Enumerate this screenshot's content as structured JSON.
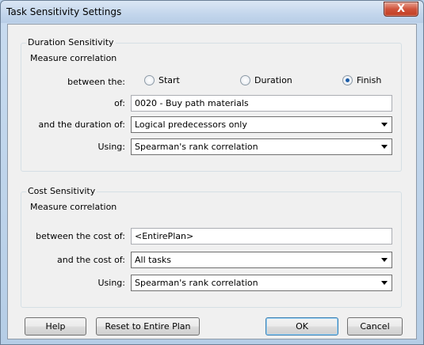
{
  "window": {
    "title": "Task Sensitivity Settings",
    "close_glyph": "X"
  },
  "duration": {
    "legend": "Duration Sensitivity",
    "measure": "Measure correlation",
    "between_label": "between the:",
    "radios": [
      {
        "label": "Start",
        "selected": false
      },
      {
        "label": "Duration",
        "selected": false
      },
      {
        "label": "Finish",
        "selected": true
      }
    ],
    "of_label": "of:",
    "of_value": "0020 - Buy path materials",
    "duration_of_label": "and the duration of:",
    "duration_of_value": "Logical predecessors only",
    "using_label": "Using:",
    "using_value": "Spearman's rank correlation"
  },
  "cost": {
    "legend": "Cost Sensitivity",
    "measure": "Measure correlation",
    "between_label": "between the cost of:",
    "between_value": "<EntirePlan>",
    "cost_of_label": "and the cost of:",
    "cost_of_value": "All tasks",
    "using_label": "Using:",
    "using_value": "Spearman's rank correlation"
  },
  "buttons": {
    "help": "Help",
    "reset": "Reset to Entire Plan",
    "ok": "OK",
    "cancel": "Cancel"
  }
}
